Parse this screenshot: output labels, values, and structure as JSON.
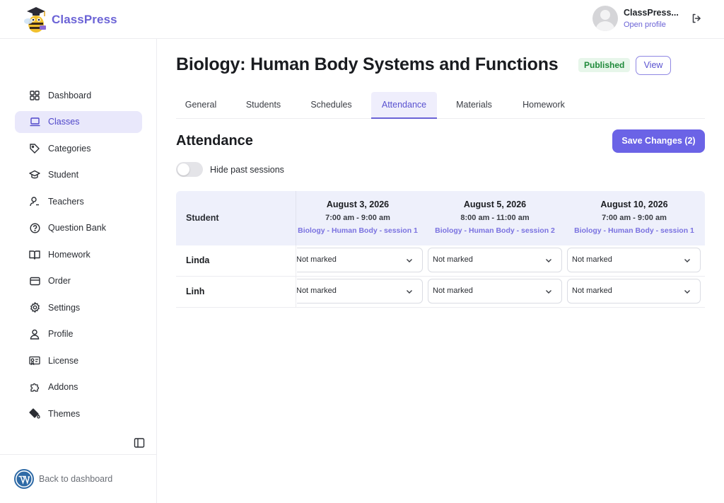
{
  "app": {
    "name": "ClassPress"
  },
  "user": {
    "name": "ClassPress...",
    "profile_link": "Open profile"
  },
  "sidebar": {
    "items": [
      {
        "label": "Dashboard",
        "icon": "grid-icon"
      },
      {
        "label": "Classes",
        "icon": "laptop-icon",
        "active": true
      },
      {
        "label": "Categories",
        "icon": "tag-icon"
      },
      {
        "label": "Student",
        "icon": "graduation-cap-icon"
      },
      {
        "label": "Teachers",
        "icon": "user-teacher-icon"
      },
      {
        "label": "Question Bank",
        "icon": "question-circle-icon"
      },
      {
        "label": "Homework",
        "icon": "book-open-icon"
      },
      {
        "label": "Order",
        "icon": "credit-card-icon"
      },
      {
        "label": "Settings",
        "icon": "gear-icon"
      },
      {
        "label": "Profile",
        "icon": "user-icon"
      },
      {
        "label": "License",
        "icon": "license-icon"
      },
      {
        "label": "Addons",
        "icon": "puzzle-icon"
      },
      {
        "label": "Themes",
        "icon": "paint-bucket-icon"
      }
    ],
    "back_label": "Back to dashboard"
  },
  "page": {
    "title": "Biology: Human Body Systems and Functions",
    "status": "Published",
    "view_label": "View"
  },
  "tabs": [
    {
      "label": "General"
    },
    {
      "label": "Students"
    },
    {
      "label": "Schedules"
    },
    {
      "label": "Attendance",
      "active": true
    },
    {
      "label": "Materials"
    },
    {
      "label": "Homework"
    }
  ],
  "attendance": {
    "title": "Attendance",
    "save_label": "Save Changes (2)",
    "toggle_label": "Hide past sessions",
    "student_header": "Student",
    "sessions": [
      {
        "date": "August 3, 2026",
        "time": "7:00 am - 9:00 am",
        "name": "Biology - Human Body - session 1"
      },
      {
        "date": "August 5, 2026",
        "time": "8:00 am - 11:00 am",
        "name": "Biology - Human Body - session 2"
      },
      {
        "date": "August 10, 2026",
        "time": "7:00 am - 9:00 am",
        "name": "Biology - Human Body - session 1"
      }
    ],
    "rows": [
      {
        "student": "Linda",
        "marks": [
          "Not marked",
          "Not marked",
          "Not marked"
        ]
      },
      {
        "student": "Linh",
        "marks": [
          "Not marked",
          "Not marked",
          "Not marked"
        ]
      }
    ]
  },
  "colors": {
    "accent": "#6b63e6",
    "published_bg": "#e7f6ea",
    "published_text": "#1f8a3a"
  }
}
